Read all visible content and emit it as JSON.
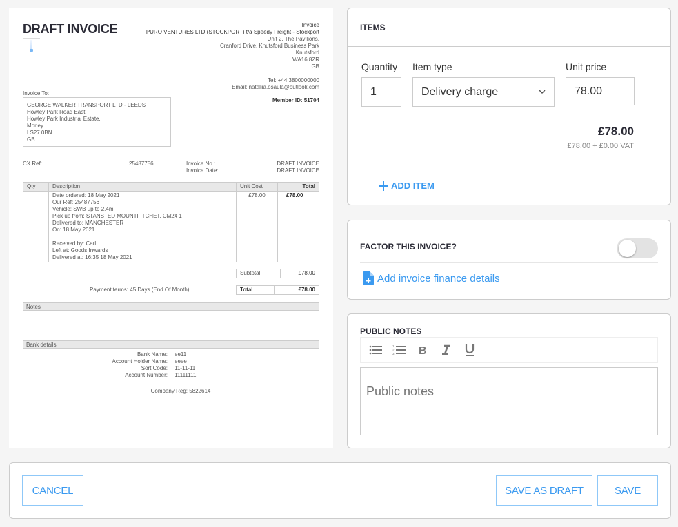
{
  "preview": {
    "title": "DRAFT INVOICE",
    "company": {
      "doc_label": "Invoice",
      "name": "PURO VENTURES LTD (STOCKPORT) t/a Speedy Freight - Stockport",
      "address": [
        "Unit 2, The Pavilions,",
        "Cranford Drive, Knutsford Business Park",
        "Knutsford",
        "WA16 8ZR",
        "GB"
      ],
      "tel": "Tel: +44 3800000000",
      "email": "Email: nataliia.osaula@outlook.com"
    },
    "member_id": "Member ID: 51704",
    "invoice_to_label": "Invoice To:",
    "invoice_to": [
      "GEORGE WALKER TRANSPORT LTD - LEEDS",
      "Howley Park Road East,",
      "Howley Park Industrial Estate,",
      "Morley",
      "LS27 0BN",
      "GB"
    ],
    "cx_ref_label": "CX Ref:",
    "cx_ref": "25487756",
    "invoice_no_label": "Invoice No.:",
    "invoice_no": "DRAFT INVOICE",
    "invoice_date_label": "Invoice Date:",
    "invoice_date": "DRAFT INVOICE",
    "table": {
      "headers": [
        "Qty",
        "Description",
        "Unit Cost",
        "Total"
      ],
      "rows": [
        {
          "qty": "",
          "description": [
            "Date ordered: 18 May 2021",
            "Our Ref: 25487756",
            "Vehicle: SWB up to 2.4m",
            "Pick up from: STANSTED MOUNTFITCHET, CM24 1",
            "Delivered to: MANCHESTER",
            "On: 18 May 2021"
          ],
          "description_extra": [
            "Received by: Carl",
            "Left at: Goods Inwards",
            "Delivered at: 16:35 18 May 2021"
          ],
          "unit_cost": "£78.00",
          "total": "£78.00"
        }
      ]
    },
    "subtotal_label": "Subtotal",
    "subtotal": "£78.00",
    "payment_terms": "Payment terms: 45 Days (End Of Month)",
    "total_label": "Total",
    "total": "£78.00",
    "notes_label": "Notes",
    "bank_label": "Bank details",
    "bank": [
      {
        "k": "Bank Name:",
        "v": "ee11"
      },
      {
        "k": "Account Holder Name:",
        "v": "eeee"
      },
      {
        "k": "Sort Code:",
        "v": "11-11-11"
      },
      {
        "k": "Account Number:",
        "v": "11111111"
      }
    ],
    "company_reg": "Company Reg: 5822614"
  },
  "items": {
    "title": "ITEMS",
    "quantity_label": "Quantity",
    "quantity": "1",
    "item_type_label": "Item type",
    "item_type": "Delivery charge",
    "unit_price_label": "Unit price",
    "unit_price": "78.00",
    "line_total": "£78.00",
    "line_vat": "£78.00 + £0.00 VAT",
    "add_item_label": "ADD ITEM"
  },
  "factor": {
    "title": "FACTOR THIS INVOICE?",
    "enabled": false,
    "finance_link": "Add invoice finance details"
  },
  "public_notes": {
    "title": "PUBLIC NOTES",
    "placeholder": "Public notes",
    "value": ""
  },
  "footer": {
    "cancel": "CANCEL",
    "save_draft": "SAVE AS DRAFT",
    "save": "SAVE"
  },
  "colors": {
    "accent": "#3b9af0",
    "button_border": "#8fc8f8",
    "background": "#f5f5f5"
  }
}
